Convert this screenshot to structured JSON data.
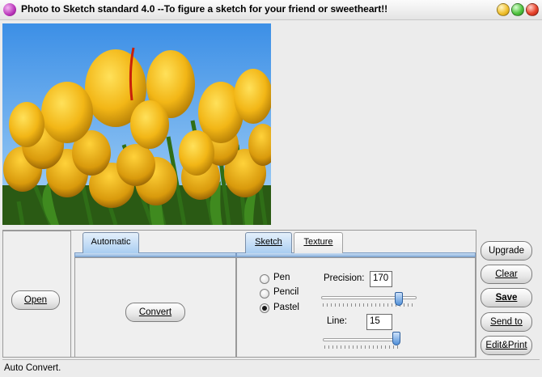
{
  "window": {
    "title": "Photo to Sketch standard 4.0 --To figure a sketch for your friend or sweetheart!!"
  },
  "left": {
    "open_label": "Open"
  },
  "automatic": {
    "tab_label": "Automatic",
    "convert_label": "Convert"
  },
  "tabs": {
    "sketch_label": "Sketch",
    "texture_label": "Texture"
  },
  "sketch": {
    "styles": [
      {
        "label": "Pen",
        "checked": false
      },
      {
        "label": "Pencil",
        "checked": false
      },
      {
        "label": "Pastel",
        "checked": true
      }
    ],
    "precision_label": "Precision:",
    "precision_value": "170",
    "line_label": "Line:",
    "line_value": "15"
  },
  "actions": {
    "upgrade": "Upgrade",
    "clear": "Clear",
    "save": "Save",
    "send_to": "Send to",
    "edit_print": "Edit&Print"
  },
  "status": {
    "text": "Auto Convert."
  },
  "icons": {
    "app": "app-icon",
    "minimize": "minimize-icon",
    "maximize": "maximize-icon",
    "close": "close-icon"
  }
}
